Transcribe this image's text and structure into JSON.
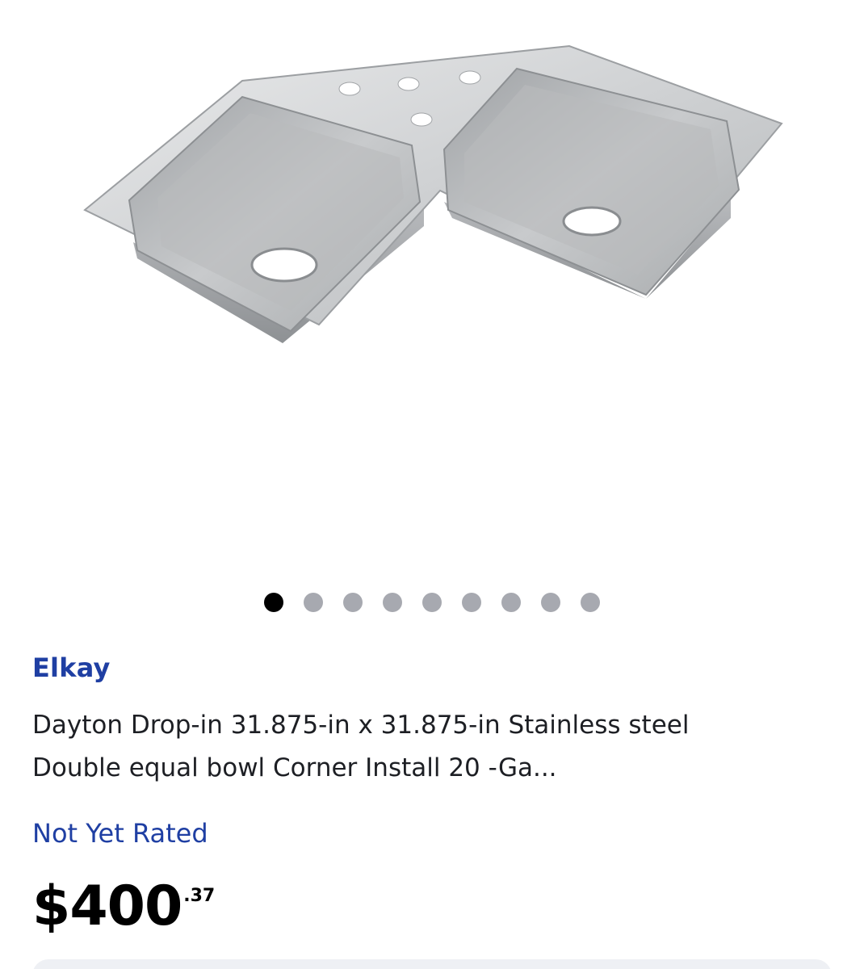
{
  "product": {
    "image_alt": "corner double bowl stainless steel sink",
    "carousel": {
      "count": 9,
      "active_index": 0
    },
    "brand": "Elkay",
    "title": "Dayton Drop-in 31.875-in x 31.875-in Stainless steel Double equal bowl Corner Install 20 -Ga...",
    "rating_text": "Not Yet Rated",
    "price": {
      "dollars": "$400",
      "cents": ".37"
    }
  },
  "colors": {
    "brand_blue": "#1f3fa3",
    "dot_inactive": "#a7a9b0",
    "dot_active": "#000000"
  }
}
